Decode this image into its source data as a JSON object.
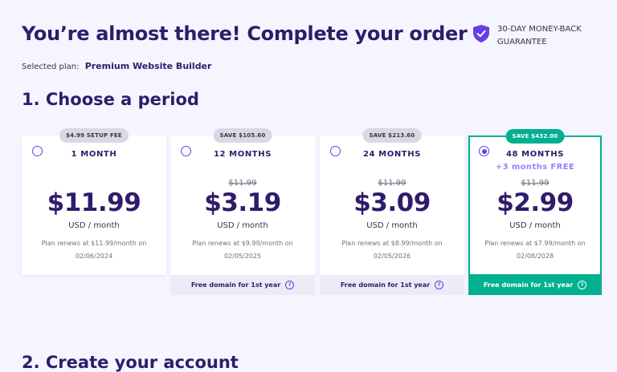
{
  "header": {
    "title": "You’re almost there! Complete your order",
    "guarantee": "30-DAY MONEY-BACK GUARANTEE"
  },
  "selected_plan": {
    "label": "Selected plan:",
    "name": "Premium Website Builder"
  },
  "section1_title": "1. Choose a period",
  "section2_title": "2. Create your account",
  "cards": [
    {
      "badge": "$4.99 SETUP FEE",
      "period": "1 MONTH",
      "bonus": "",
      "old_price": "",
      "price": "$11.99",
      "unit": "USD / month",
      "renew_line1": "Plan renews at $11.99/month on",
      "renew_line2": "02/06/2024",
      "footer": "",
      "selected": false
    },
    {
      "badge": "SAVE $105.60",
      "period": "12 MONTHS",
      "bonus": "",
      "old_price": "$11.99",
      "price": "$3.19",
      "unit": "USD / month",
      "renew_line1": "Plan renews at $9.99/month on",
      "renew_line2": "02/05/2025",
      "footer": "Free domain for 1st year",
      "selected": false
    },
    {
      "badge": "SAVE $213.60",
      "period": "24 MONTHS",
      "bonus": "",
      "old_price": "$11.99",
      "price": "$3.09",
      "unit": "USD / month",
      "renew_line1": "Plan renews at $8.99/month on",
      "renew_line2": "02/05/2026",
      "footer": "Free domain for 1st year",
      "selected": false
    },
    {
      "badge": "SAVE $432.00",
      "period": "48 MONTHS",
      "bonus": "+3 months FREE",
      "old_price": "$11.99",
      "price": "$2.99",
      "unit": "USD / month",
      "renew_line1": "Plan renews at $7.99/month on",
      "renew_line2": "02/08/2028",
      "footer": "Free domain for 1st year",
      "selected": true
    }
  ],
  "help_icon": "question-mark",
  "colors": {
    "primary": "#673de6",
    "heading": "#2f1c6a",
    "accent_green": "#00b090",
    "background": "#f4f5ff"
  }
}
